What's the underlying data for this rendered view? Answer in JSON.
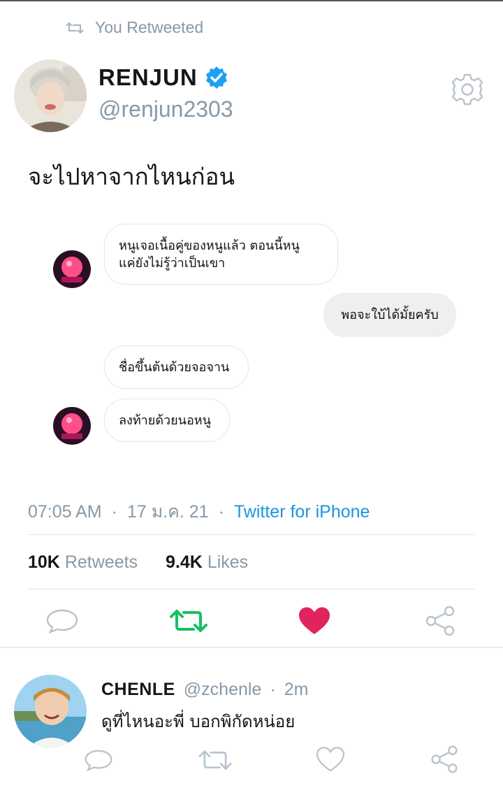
{
  "retweet_label": "You Retweeted",
  "tweet": {
    "author_name": "RENJUN",
    "author_handle": "@renjun2303",
    "text": "จะไปหาจากไหนก่อน",
    "chat": [
      {
        "from": "other",
        "text_line1": "หนูเจอเนื้อคู่ของหนูแล้ว ตอนนี้หนู",
        "text_line2": "แค่ยังไม่รู้ว่าเป็นเขา"
      },
      {
        "from": "me",
        "text": "พอจะใบ้ได้มั้ยครับ"
      },
      {
        "from": "other",
        "text": "ชื่อขึ้นต้นด้วยจอจาน"
      },
      {
        "from": "other",
        "text": "ลงท้ายด้วยนอหนู"
      }
    ],
    "time": "07:05 AM",
    "date": "17 ม.ค. 21",
    "source": "Twitter for iPhone",
    "retweets_count": "10K",
    "retweets_label": "Retweets",
    "likes_count": "9.4K",
    "likes_label": "Likes"
  },
  "reply": {
    "author_name": "CHENLE",
    "author_handle": "@zchenle",
    "time_ago": "2m",
    "text": "ดูที่ไหนอะพี่ บอกพิกัดหน่อย"
  },
  "colors": {
    "accent": "#1b95e0",
    "retweet_green": "#17bf63",
    "like_red": "#e0245e",
    "muted": "#8899a6",
    "verified": "#1da1f2"
  },
  "icons": [
    "retweet-icon",
    "verified-badge-icon",
    "settings-gear-icon",
    "reply-icon",
    "heart-icon",
    "share-icon"
  ]
}
